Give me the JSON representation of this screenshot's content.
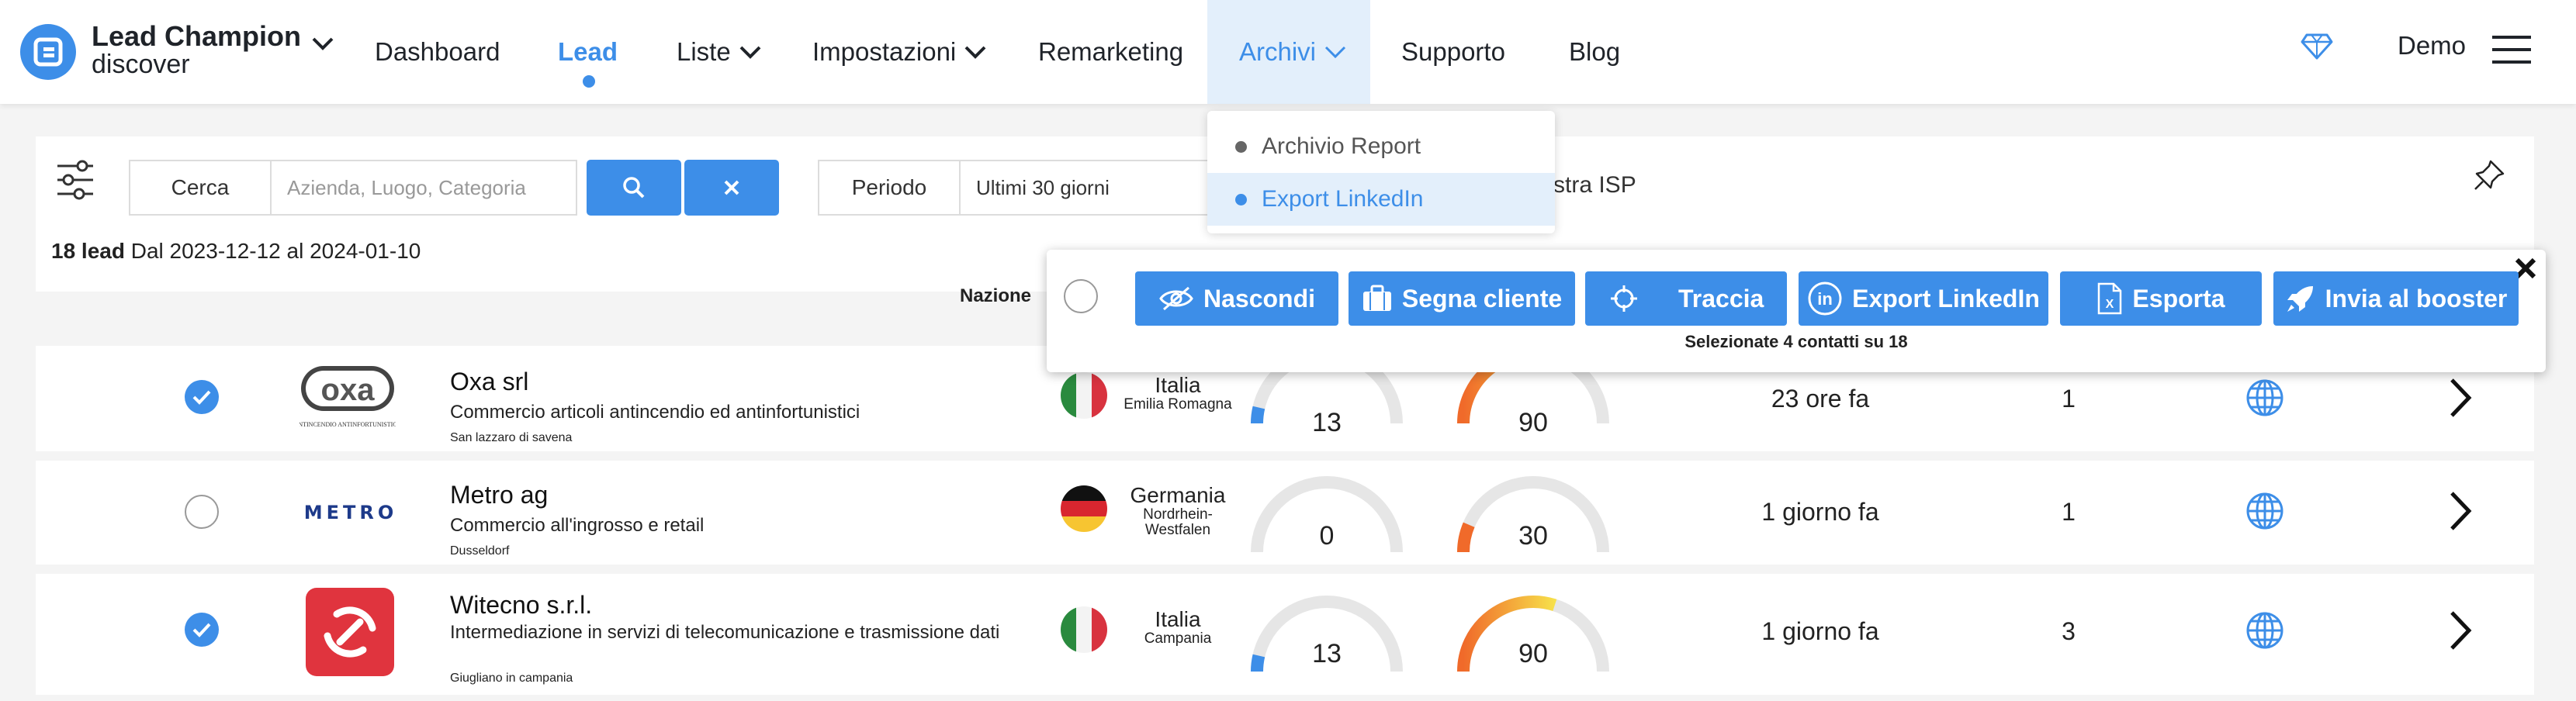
{
  "brand": {
    "name": "Lead Champion",
    "subtitle": "discover"
  },
  "nav": {
    "items": [
      {
        "label": "Dashboard"
      },
      {
        "label": "Lead"
      },
      {
        "label": "Liste"
      },
      {
        "label": "Impostazioni"
      },
      {
        "label": "Remarketing"
      },
      {
        "label": "Archivi"
      },
      {
        "label": "Supporto"
      },
      {
        "label": "Blog"
      }
    ],
    "active": "Lead",
    "open_menu": "Archivi"
  },
  "user": {
    "name": "Demo"
  },
  "archivi_menu": {
    "items": [
      {
        "label": "Archivio Report"
      },
      {
        "label": "Export LinkedIn"
      }
    ],
    "highlighted": "Export LinkedIn"
  },
  "filters": {
    "search_label": "Cerca",
    "search_placeholder": "Azienda, Luogo, Categoria",
    "period_label": "Periodo",
    "period_value": "Ultimi 30 giorni",
    "isp_text": "stra ISP"
  },
  "summary": {
    "count": "18 lead",
    "range": "Dal 2023-12-12 al 2024-01-10"
  },
  "columns": {
    "nazione": "Nazione"
  },
  "selection": {
    "actions": [
      {
        "label": "Nascondi",
        "icon": "eye-slash-icon"
      },
      {
        "label": "Segna cliente",
        "icon": "briefcase-icon"
      },
      {
        "label": "Traccia",
        "icon": "crosshair-icon"
      },
      {
        "label": "Export LinkedIn",
        "icon": "linkedin-icon"
      },
      {
        "label": "Esporta",
        "icon": "excel-file-icon"
      },
      {
        "label": "Invia al booster",
        "icon": "rocket-icon"
      }
    ],
    "info": "Selezionate 4 contatti su 18"
  },
  "leads": [
    {
      "name": "Oxa srl",
      "description": "Commercio articoli antincendio ed antinfortunistici",
      "city": "San lazzaro di savena",
      "logo_text": "oxa",
      "logo_caption": "ANTINCENDIO ANTINFORTUNISTICA",
      "country": "Italia",
      "region": "Emilia Romagna",
      "score_a": "13",
      "score_b": "90",
      "last_visit": "23 ore fa",
      "visits": "1",
      "checked": true
    },
    {
      "name": "Metro ag",
      "description": "Commercio all'ingrosso e retail",
      "city": "Dusseldorf",
      "logo_text": "METRO",
      "country": "Germania",
      "region": "Nordrhein-Westfalen",
      "score_a": "0",
      "score_b": "30",
      "last_visit": "1 giorno fa",
      "visits": "1",
      "checked": false
    },
    {
      "name": "Witecno s.r.l.",
      "description": "Intermediazione in servizi di telecomunicazione e trasmissione dati",
      "city": "Giugliano in campania",
      "country": "Italia",
      "region": "Campania",
      "score_a": "13",
      "score_b": "90",
      "last_visit": "1 giorno fa",
      "visits": "3",
      "checked": true
    }
  ],
  "colors": {
    "accent": "#3d8ee8",
    "brand_red": "#e0343e",
    "gauge_track": "#e6e6e6"
  }
}
